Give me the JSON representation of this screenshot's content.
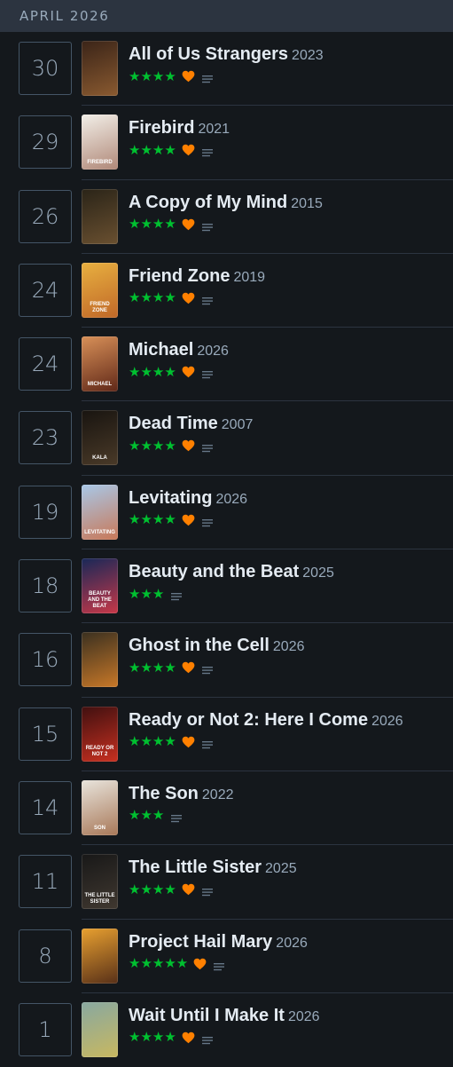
{
  "header": {
    "month_label": "APRIL 2026"
  },
  "colors": {
    "star": "#00c030",
    "heart": "#ff8000",
    "background": "#14181c"
  },
  "entries": [
    {
      "day": "30",
      "title": "All of Us Strangers",
      "year": "2023",
      "stars": "★★★★",
      "liked": true,
      "review": true,
      "poster_colors": [
        "#3a2418",
        "#8a5a30"
      ],
      "poster_text": ""
    },
    {
      "day": "29",
      "title": "Firebird",
      "year": "2021",
      "stars": "★★★★",
      "liked": true,
      "review": true,
      "poster_colors": [
        "#f2efe8",
        "#b08878"
      ],
      "poster_text": "Firebird"
    },
    {
      "day": "26",
      "title": "A Copy of My Mind",
      "year": "2015",
      "stars": "★★★★",
      "liked": true,
      "review": true,
      "poster_colors": [
        "#2a2418",
        "#6a5030"
      ],
      "poster_text": ""
    },
    {
      "day": "24",
      "title": "Friend Zone",
      "year": "2019",
      "stars": "★★★★",
      "liked": true,
      "review": true,
      "poster_colors": [
        "#e8b040",
        "#c06828"
      ],
      "poster_text": "Friend Zone"
    },
    {
      "day": "24",
      "title": "Michael",
      "year": "2026",
      "stars": "★★★★",
      "liked": true,
      "review": true,
      "poster_colors": [
        "#d89058",
        "#602818"
      ],
      "poster_text": "Michael"
    },
    {
      "day": "23",
      "title": "Dead Time",
      "year": "2007",
      "stars": "★★★★",
      "liked": true,
      "review": true,
      "poster_colors": [
        "#181410",
        "#4a3a28"
      ],
      "poster_text": "Kala"
    },
    {
      "day": "19",
      "title": "Levitating",
      "year": "2026",
      "stars": "★★★★",
      "liked": true,
      "review": true,
      "poster_colors": [
        "#a8c8e8",
        "#c87858"
      ],
      "poster_text": "Levitating"
    },
    {
      "day": "18",
      "title": "Beauty and the Beat",
      "year": "2025",
      "stars": "★★★",
      "liked": false,
      "review": true,
      "poster_colors": [
        "#182858",
        "#c83848"
      ],
      "poster_text": "Beauty and the Beat"
    },
    {
      "day": "16",
      "title": "Ghost in the Cell",
      "year": "2026",
      "stars": "★★★★",
      "liked": true,
      "review": true,
      "poster_colors": [
        "#3a3020",
        "#c87828"
      ],
      "poster_text": ""
    },
    {
      "day": "15",
      "title": "Ready or Not 2: Here I Come",
      "year": "2026",
      "stars": "★★★★",
      "liked": true,
      "review": true,
      "poster_colors": [
        "#401010",
        "#c83020"
      ],
      "poster_text": "Ready or Not 2"
    },
    {
      "day": "14",
      "title": "The Son",
      "year": "2022",
      "stars": "★★★",
      "liked": false,
      "review": true,
      "poster_colors": [
        "#e8e4dc",
        "#a87858"
      ],
      "poster_text": "Son"
    },
    {
      "day": "11",
      "title": "The Little Sister",
      "year": "2025",
      "stars": "★★★★",
      "liked": true,
      "review": true,
      "poster_colors": [
        "#181818",
        "#403830"
      ],
      "poster_text": "The Little Sister"
    },
    {
      "day": "8",
      "title": "Project Hail Mary",
      "year": "2026",
      "stars": "★★★★★",
      "liked": true,
      "review": true,
      "poster_colors": [
        "#e8a030",
        "#583018"
      ],
      "poster_text": ""
    },
    {
      "day": "1",
      "title": "Wait Until I Make It",
      "year": "2026",
      "stars": "★★★★",
      "liked": true,
      "review": true,
      "poster_colors": [
        "#88a8a0",
        "#c8b860"
      ],
      "poster_text": ""
    }
  ]
}
